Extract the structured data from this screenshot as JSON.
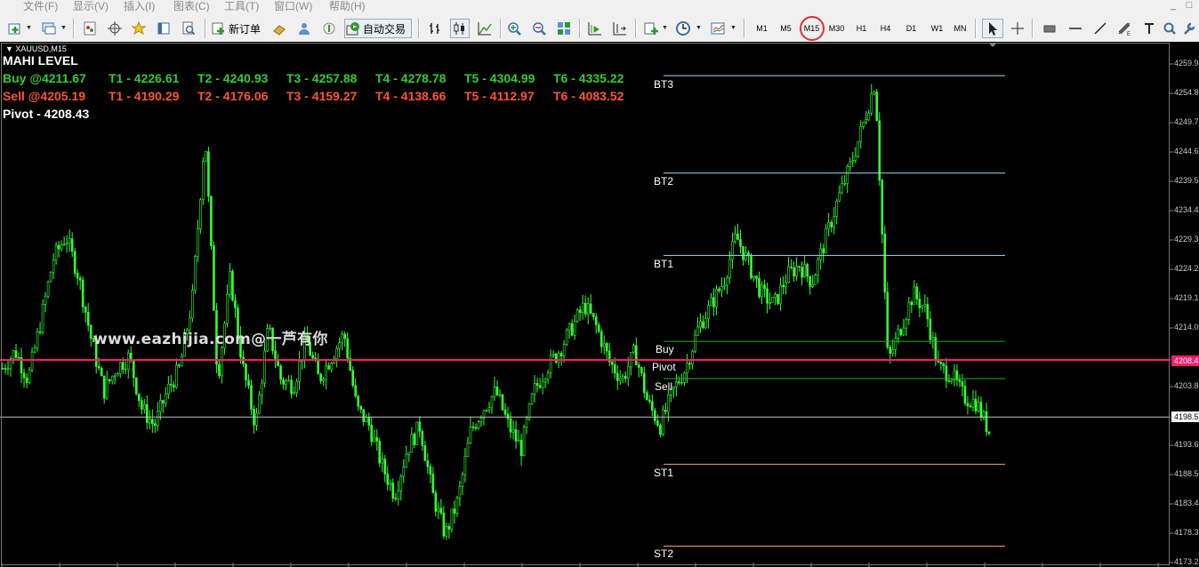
{
  "menu": {
    "items": [
      "文件(F)",
      "显示(V)",
      "插入(I)",
      "图表(C)",
      "工具(T)",
      "窗口(W)",
      "帮助(H)"
    ],
    "window_controls": [
      "_",
      "□"
    ]
  },
  "toolbar": {
    "new_order_label": "新订单",
    "auto_trade_label": "自动交易",
    "timeframes": [
      "M1",
      "M5",
      "M15",
      "M30",
      "H1",
      "H4",
      "D1",
      "W1",
      "MN"
    ],
    "highlighted_timeframe": "M15",
    "highlight_color": "#e03030"
  },
  "chart": {
    "symbol": "XAUUSD,M15",
    "indicator_title": "MAHI LEVEL",
    "buy_entry": "Buy @4211.67",
    "buy_targets": [
      "T1 - 4226.61",
      "T2 - 4240.93",
      "T3 - 4257.88",
      "T4 - 4278.78",
      "T5 - 4304.99",
      "T6 - 4335.22"
    ],
    "sell_entry": "Sell @4205.19",
    "sell_targets": [
      "T1 - 4190.29",
      "T2 - 4176.06",
      "T3 - 4159.27",
      "T4 - 4138.66",
      "T5 - 4112.97",
      "T6 - 4083.52"
    ],
    "pivot_text": "Pivot - 4208.43",
    "watermark": "www.eazhijia.com@一芦有你",
    "colors": {
      "buy": "#33cc33",
      "sell": "#ff5533",
      "candles": "#33ff33",
      "pivot_line": "#ff1a6e",
      "current_price_line": "#c0c0c0",
      "bt_lines": "#a8d8f0",
      "buy_sell_lines": "#2ea82e",
      "st_lines": "#f0a070"
    },
    "level_labels": {
      "bt3": "BT3",
      "bt2": "BT2",
      "bt1": "BT1",
      "buy": "Buy",
      "pivot": "Pivot",
      "sell": "Sell",
      "st1": "ST1",
      "st2": "ST2"
    },
    "price_axis": [
      "4259.9",
      "4254.8",
      "4249.7",
      "4244.6",
      "4239.5",
      "4234.4",
      "4229.3",
      "4224.2",
      "4219.1",
      "4214.0",
      "4203.8",
      "4193.6",
      "4188.5",
      "4183.4",
      "4178.3",
      "4173.2"
    ],
    "pivot_tag": "4208.4",
    "current_price_tag": "4198.5"
  },
  "chart_data": {
    "type": "candlestick",
    "symbol": "XAUUSD",
    "timeframe": "M15",
    "y_range": [
      4173.2,
      4259.9
    ],
    "levels": {
      "BT3": 4257.88,
      "BT2": 4240.93,
      "BT1": 4226.61,
      "Buy": 4211.67,
      "Pivot": 4208.43,
      "Sell": 4205.19,
      "ST1": 4190.29,
      "ST2": 4176.06
    },
    "current_price": 4198.5,
    "close_path": [
      4207,
      4210,
      4205,
      4215,
      4226,
      4230,
      4223,
      4212,
      4203,
      4207,
      4209,
      4200,
      4197,
      4203,
      4207,
      4219,
      4248,
      4205,
      4223,
      4207,
      4197,
      4214,
      4205,
      4204,
      4212,
      4205,
      4209,
      4213,
      4200,
      4197,
      4190,
      4185,
      4193,
      4197,
      4185,
      4178,
      4184,
      4196,
      4200,
      4203,
      4197,
      4193,
      4203,
      4207,
      4210,
      4214,
      4218,
      4214,
      4208,
      4205,
      4210,
      4201,
      4197,
      4203,
      4207,
      4214,
      4218,
      4222,
      4230,
      4225,
      4220,
      4218,
      4223,
      4225,
      4222,
      4229,
      4236,
      4242,
      4249,
      4257,
      4208,
      4214,
      4220,
      4217,
      4207,
      4206,
      4202,
      4201,
      4196
    ]
  }
}
